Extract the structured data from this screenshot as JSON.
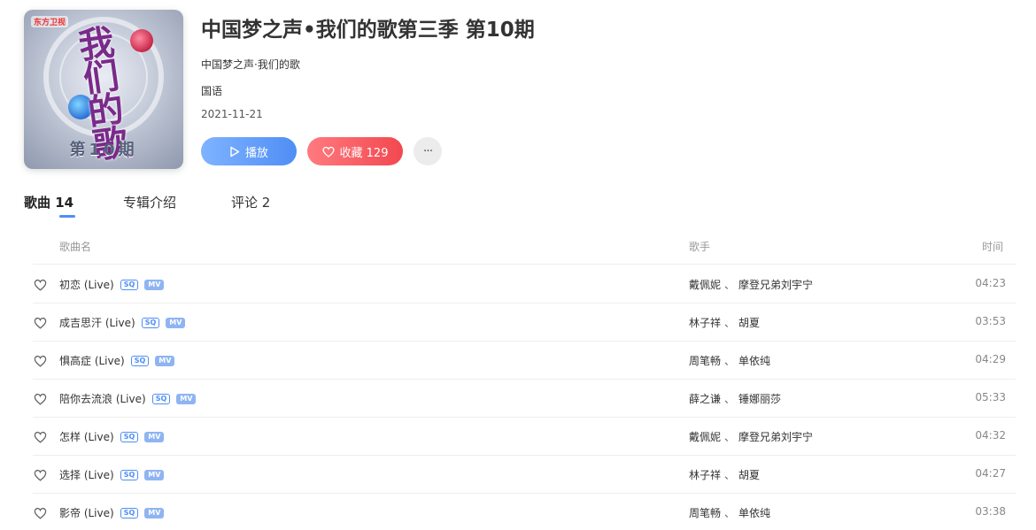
{
  "album": {
    "cover_logo": "东方卫视",
    "cover_title_art": "我们的歌",
    "cover_episode": "第10期",
    "title": "中国梦之声•我们的歌第三季 第10期",
    "artist": "中国梦之声·我们的歌",
    "language": "国语",
    "release_date": "2021-11-21"
  },
  "actions": {
    "play_label": "播放",
    "favorite_label": "收藏 129",
    "more_label": "···"
  },
  "tabs": [
    {
      "label": "歌曲",
      "count": "14"
    },
    {
      "label": "专辑介绍"
    },
    {
      "label": "评论",
      "count": "2"
    }
  ],
  "table": {
    "headers": {
      "name": "歌曲名",
      "singer": "歌手",
      "duration": "时间"
    },
    "tag_sq": "SQ",
    "tag_mv": "MV",
    "rows": [
      {
        "title": "初恋 (Live)",
        "singer1": "戴佩妮",
        "singer2": "摩登兄弟刘宇宁",
        "duration": "04:23"
      },
      {
        "title": "成吉思汗 (Live)",
        "singer1": "林子祥",
        "singer2": "胡夏",
        "duration": "03:53"
      },
      {
        "title": "惧高症 (Live)",
        "singer1": "周笔畅",
        "singer2": "单依纯",
        "duration": "04:29"
      },
      {
        "title": "陪你去流浪 (Live)",
        "singer1": "薛之谦",
        "singer2": "锤娜丽莎",
        "duration": "05:33"
      },
      {
        "title": "怎样 (Live)",
        "singer1": "戴佩妮",
        "singer2": "摩登兄弟刘宇宁",
        "duration": "04:32"
      },
      {
        "title": "选择 (Live)",
        "singer1": "林子祥",
        "singer2": "胡夏",
        "duration": "04:27"
      },
      {
        "title": "影帝 (Live)",
        "singer1": "周笔畅",
        "singer2": "单依纯",
        "duration": "03:38"
      }
    ]
  },
  "colors": {
    "accent_blue": "#4f8ef5",
    "favorite_red": "#f2484f"
  }
}
